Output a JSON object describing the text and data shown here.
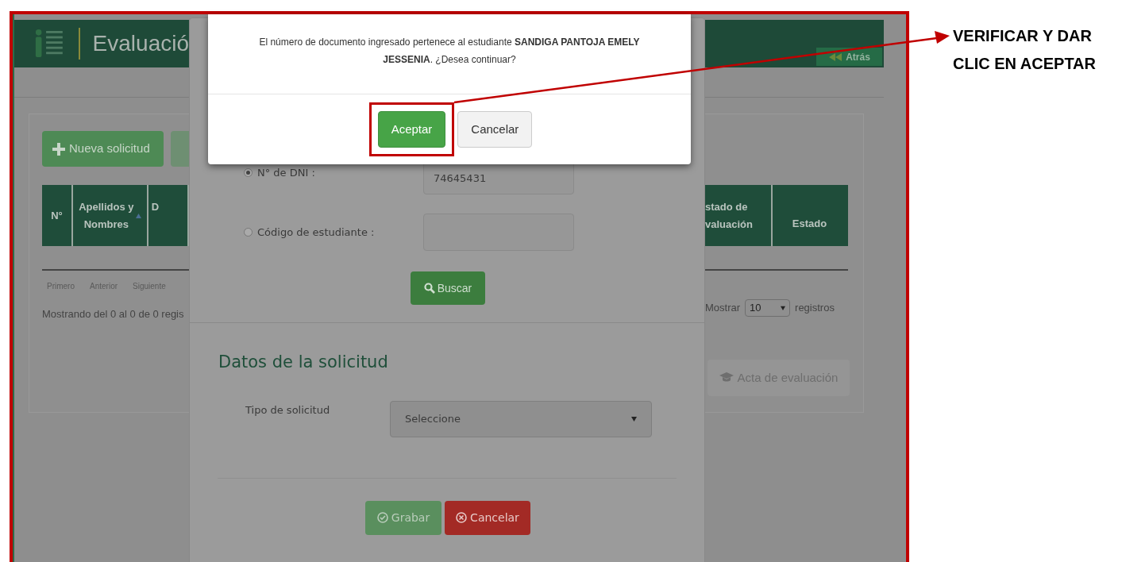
{
  "header": {
    "title": "Evaluació",
    "back_button": "Atrás"
  },
  "toolbar": {
    "new_button": "Nueva solicitud"
  },
  "table": {
    "columns_left": [
      "N°",
      "Apellidos y Nombres",
      "D"
    ],
    "columns_right": [
      "stado de valuación",
      "Estado"
    ]
  },
  "pagination": [
    "Primero",
    "Anterior",
    "Siguiente"
  ],
  "info": "Mostrando del 0 al 0 de 0 regis",
  "page_size": {
    "label_before": "Mostrar",
    "value": "10",
    "label_after": "registros"
  },
  "report_button": "Acta de evaluación",
  "form": {
    "search_options": [
      {
        "label": "N° de DNI :",
        "selected": true,
        "value": "74645431"
      },
      {
        "label": "Código de estudiante :",
        "selected": false
      }
    ],
    "search_button": "Buscar",
    "section_title": "Datos de la solicitud",
    "request_type": {
      "label": "Tipo de solicitud",
      "value": "Seleccione"
    },
    "buttons": [
      {
        "label": "Grabar",
        "kind": "save"
      },
      {
        "label": "Cancelar",
        "kind": "cancel"
      }
    ]
  },
  "dialog": {
    "message": "El número de documento ingresado pertenece al estudiante **SANDIGA PANTOJA EMELY JESSENIA**. ¿Desea continuar?",
    "buttons": [
      {
        "label": "Aceptar",
        "kind": "primary",
        "highlighted": true
      },
      {
        "label": "Cancelar",
        "kind": "default",
        "highlighted": false
      }
    ]
  },
  "annotation": {
    "lines": [
      "VERIFICAR Y DAR",
      "CLIC EN ACEPTAR"
    ]
  }
}
